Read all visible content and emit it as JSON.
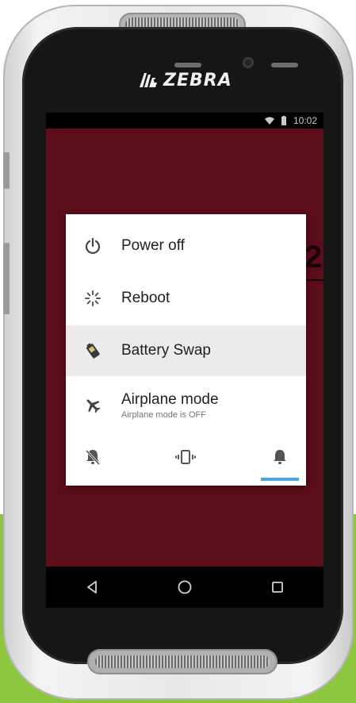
{
  "device": {
    "brand": "ZEBRA"
  },
  "status_bar": {
    "time": "10:02",
    "icons": [
      "wifi-icon",
      "battery-icon"
    ]
  },
  "power_menu": {
    "items": [
      {
        "icon": "power-icon",
        "label": "Power off",
        "sublabel": ""
      },
      {
        "icon": "reboot-icon",
        "label": "Reboot",
        "sublabel": ""
      },
      {
        "icon": "battery-swap-icon",
        "label": "Battery Swap",
        "sublabel": "",
        "highlighted": true
      },
      {
        "icon": "airplane-icon",
        "label": "Airplane mode",
        "sublabel": "Airplane mode is OFF"
      }
    ],
    "ringer_modes": [
      "silent-icon",
      "vibrate-icon",
      "sound-icon"
    ],
    "selected_ringer_mode": "sound-icon"
  },
  "nav_bar": {
    "buttons": [
      "back-icon",
      "home-icon",
      "recents-icon"
    ]
  },
  "colors": {
    "screen_background": "#5b0d1a",
    "dialog_background": "#ffffff",
    "highlight": "#ebebeb",
    "accent": "#4aa7d8",
    "backdrop_green": "#8dc63f"
  }
}
